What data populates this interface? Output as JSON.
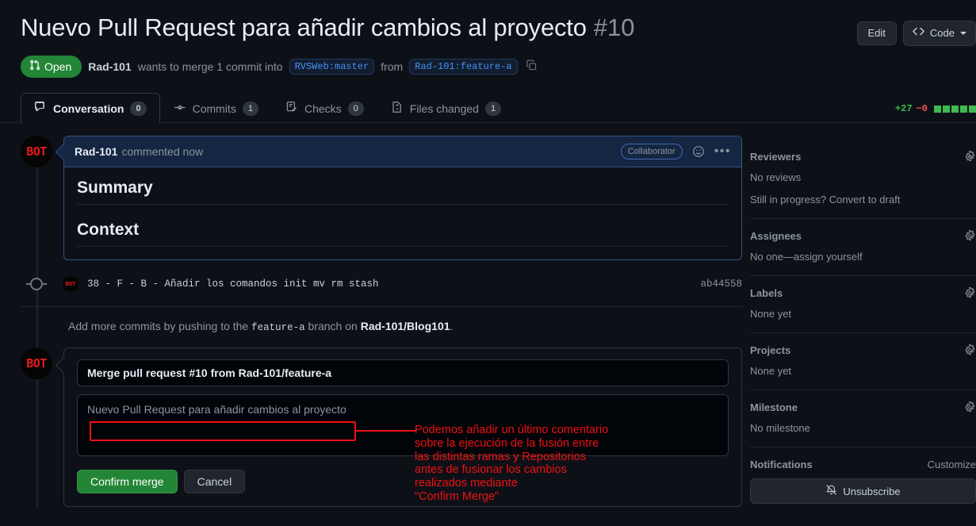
{
  "header": {
    "title": "Nuevo Pull Request para añadir cambios al proyecto",
    "number": "#10",
    "edit_label": "Edit",
    "code_label": "Code"
  },
  "meta": {
    "state": "Open",
    "author": "Rad-101",
    "wants_text": "wants to merge 1 commit into",
    "base_branch": "RVSWeb:master",
    "from_text": "from",
    "head_branch": "Rad-101:feature-a"
  },
  "tabs": [
    {
      "label": "Conversation",
      "count": "0",
      "icon": "comment-icon",
      "active": true
    },
    {
      "label": "Commits",
      "count": "1",
      "icon": "commit-icon",
      "active": false
    },
    {
      "label": "Checks",
      "count": "0",
      "icon": "checklist-icon",
      "active": false
    },
    {
      "label": "Files changed",
      "count": "1",
      "icon": "file-diff-icon",
      "active": false
    }
  ],
  "diffstat": {
    "additions": "+27",
    "deletions": "−0",
    "blocks": 5
  },
  "comment": {
    "avatar_text": "BOT",
    "author": "Rad-101",
    "when": "commented now",
    "badge": "Collaborator",
    "headings": [
      "Summary",
      "Context"
    ]
  },
  "commit": {
    "avatar_text": "BOT",
    "message": "38 - F - B - Añadir los comandos init mv rm stash",
    "hash": "ab44558"
  },
  "add_commits": {
    "prefix": "Add more commits by pushing to the",
    "branch": "feature-a",
    "middle": "branch on",
    "repo": "Rad-101/Blog101",
    "suffix": "."
  },
  "merge_form": {
    "avatar_text": "BOT",
    "title_value": "Merge pull request #10 from Rad-101/feature-a",
    "description_value": "Nuevo Pull Request para añadir cambios al proyecto",
    "confirm_label": "Confirm merge",
    "cancel_label": "Cancel"
  },
  "annotation": {
    "text": "Podemos añadir un último comentario\nsobre la ejecución de la fusión entre\nlas distintas ramas y Repositorios\nantes de fusionar los cambios\nrealizados mediante\n\"Confirm Merge\"",
    "color": "#ee1111"
  },
  "sidebar": {
    "sections": [
      {
        "title": "Reviewers",
        "lines": [
          "No reviews",
          "Still in progress? Convert to draft"
        ]
      },
      {
        "title": "Assignees",
        "lines": [
          "No one—assign yourself"
        ]
      },
      {
        "title": "Labels",
        "lines": [
          "None yet"
        ]
      },
      {
        "title": "Projects",
        "lines": [
          "None yet"
        ]
      },
      {
        "title": "Milestone",
        "lines": [
          "No milestone"
        ]
      }
    ],
    "notifications": {
      "title": "Notifications",
      "customize": "Customize",
      "unsubscribe": "Unsubscribe"
    }
  },
  "colors": {
    "background": "#0d1117",
    "open_green": "#238636",
    "accent_blue": "#4493f8",
    "annotation_red": "#ee1111",
    "additions_green": "#3fb950",
    "deletions_red": "#f85149"
  }
}
